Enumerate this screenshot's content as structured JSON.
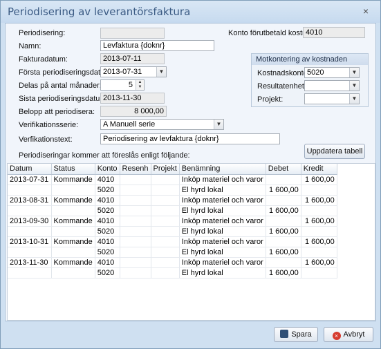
{
  "window": {
    "title": "Periodisering av leverantörsfaktura",
    "close_glyph": "×"
  },
  "form": {
    "periodisering": {
      "label": "Periodisering:",
      "value": ""
    },
    "namn": {
      "label": "Namn:",
      "value": "Levfaktura {doknr}"
    },
    "fakturadatum": {
      "label": "Fakturadatum:",
      "value": "2013-07-11"
    },
    "forsta_datum": {
      "label": "Första periodiseringsdatum:",
      "value": "2013-07-31"
    },
    "delas": {
      "label": "Delas på antal månader:",
      "value": "5"
    },
    "sista_datum": {
      "label": "Sista periodiseringsdatum:",
      "value": "2013-11-30"
    },
    "belopp": {
      "label": "Belopp att periodisera:",
      "value": "8 000,00"
    },
    "verifikationsserie": {
      "label": "Verifikationsserie:",
      "value": "A Manuell serie"
    },
    "verifikationstext": {
      "label": "Verfikationstext:",
      "value": "Periodisering av levfaktura {doknr}"
    },
    "konto_forutbetald": {
      "label": "Konto förutbetald kostnad:",
      "value": "4010"
    }
  },
  "motkontering": {
    "title": "Motkontering av kostnaden",
    "kostnadskonto": {
      "label": "Kostnadskonto:",
      "value": "5020"
    },
    "resultatenhet": {
      "label": "Resultatenhet:",
      "value": ""
    },
    "projekt": {
      "label": "Projekt:",
      "value": ""
    }
  },
  "hint": "Periodiseringar kommer att föreslås enligt följande:",
  "update_button": "Uppdatera tabell",
  "table": {
    "columns": [
      "Datum",
      "Status",
      "Konto",
      "Resenh",
      "Projekt",
      "Benämning",
      "Debet",
      "Kredit"
    ],
    "rows": [
      [
        "2013-07-31",
        "Kommande",
        "4010",
        "",
        "",
        "Inköp materiel och varor",
        "",
        "1 600,00"
      ],
      [
        "",
        "",
        "5020",
        "",
        "",
        "El hyrd lokal",
        "1 600,00",
        ""
      ],
      [
        "2013-08-31",
        "Kommande",
        "4010",
        "",
        "",
        "Inköp materiel och varor",
        "",
        "1 600,00"
      ],
      [
        "",
        "",
        "5020",
        "",
        "",
        "El hyrd lokal",
        "1 600,00",
        ""
      ],
      [
        "2013-09-30",
        "Kommande",
        "4010",
        "",
        "",
        "Inköp materiel och varor",
        "",
        "1 600,00"
      ],
      [
        "",
        "",
        "5020",
        "",
        "",
        "El hyrd lokal",
        "1 600,00",
        ""
      ],
      [
        "2013-10-31",
        "Kommande",
        "4010",
        "",
        "",
        "Inköp materiel och varor",
        "",
        "1 600,00"
      ],
      [
        "",
        "",
        "5020",
        "",
        "",
        "El hyrd lokal",
        "1 600,00",
        ""
      ],
      [
        "2013-11-30",
        "Kommande",
        "4010",
        "",
        "",
        "Inköp materiel och varor",
        "",
        "1 600,00"
      ],
      [
        "",
        "",
        "5020",
        "",
        "",
        "El hyrd lokal",
        "1 600,00",
        ""
      ]
    ]
  },
  "buttons": {
    "save": "Spara",
    "cancel": "Avbryt"
  }
}
